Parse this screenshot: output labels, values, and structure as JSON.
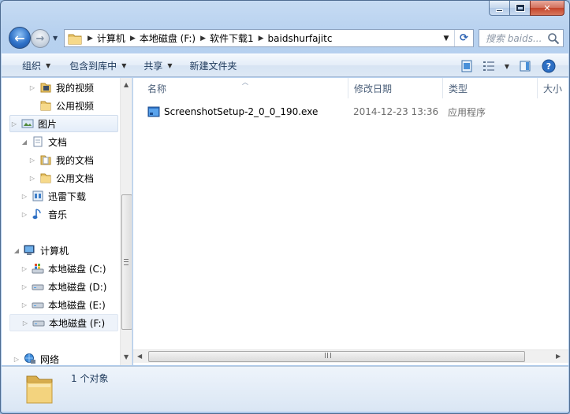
{
  "window": {
    "caption": {
      "minimize": "",
      "maximize": "",
      "close": "✕"
    }
  },
  "nav": {
    "back_glyph": "←",
    "forward_glyph": "→",
    "breadcrumbs": [
      "计算机",
      "本地磁盘 (F:)",
      "软件下载1",
      "baidshurfajitc"
    ],
    "search_placeholder": "搜索 baids..."
  },
  "toolbar": {
    "organize": "组织",
    "include_in_library": "包含到库中",
    "share": "共享",
    "new_folder": "新建文件夹"
  },
  "sidebar": {
    "items": [
      {
        "label": "我的视频",
        "icon": "video-folder-icon"
      },
      {
        "label": "公用视频",
        "icon": "folder-icon"
      },
      {
        "label": "图片",
        "icon": "pictures-library-icon"
      },
      {
        "label": "文档",
        "icon": "documents-library-icon"
      },
      {
        "label": "我的文档",
        "icon": "folder-icon"
      },
      {
        "label": "公用文档",
        "icon": "folder-icon"
      },
      {
        "label": "迅雷下载",
        "icon": "download-library-icon"
      },
      {
        "label": "音乐",
        "icon": "music-library-icon"
      },
      {
        "label": "计算机",
        "icon": "computer-icon"
      },
      {
        "label": "本地磁盘 (C:)",
        "icon": "system-drive-icon"
      },
      {
        "label": "本地磁盘 (D:)",
        "icon": "drive-icon"
      },
      {
        "label": "本地磁盘 (E:)",
        "icon": "drive-icon"
      },
      {
        "label": "本地磁盘 (F:)",
        "icon": "drive-icon"
      },
      {
        "label": "网络",
        "icon": "network-icon"
      }
    ]
  },
  "columns": {
    "name": "名称",
    "date": "修改日期",
    "type": "类型",
    "size": "大小"
  },
  "files": [
    {
      "name": "ScreenshotSetup-2_0_0_190.exe",
      "date": "2014-12-23 13:36",
      "type": "应用程序",
      "icon": "exe-icon"
    }
  ],
  "details": {
    "count": "1 个对象"
  },
  "colors": {
    "accent": "#2f72c8",
    "link": "#1e395b",
    "file_name": "#000000",
    "meta": "#6d6d6d"
  }
}
